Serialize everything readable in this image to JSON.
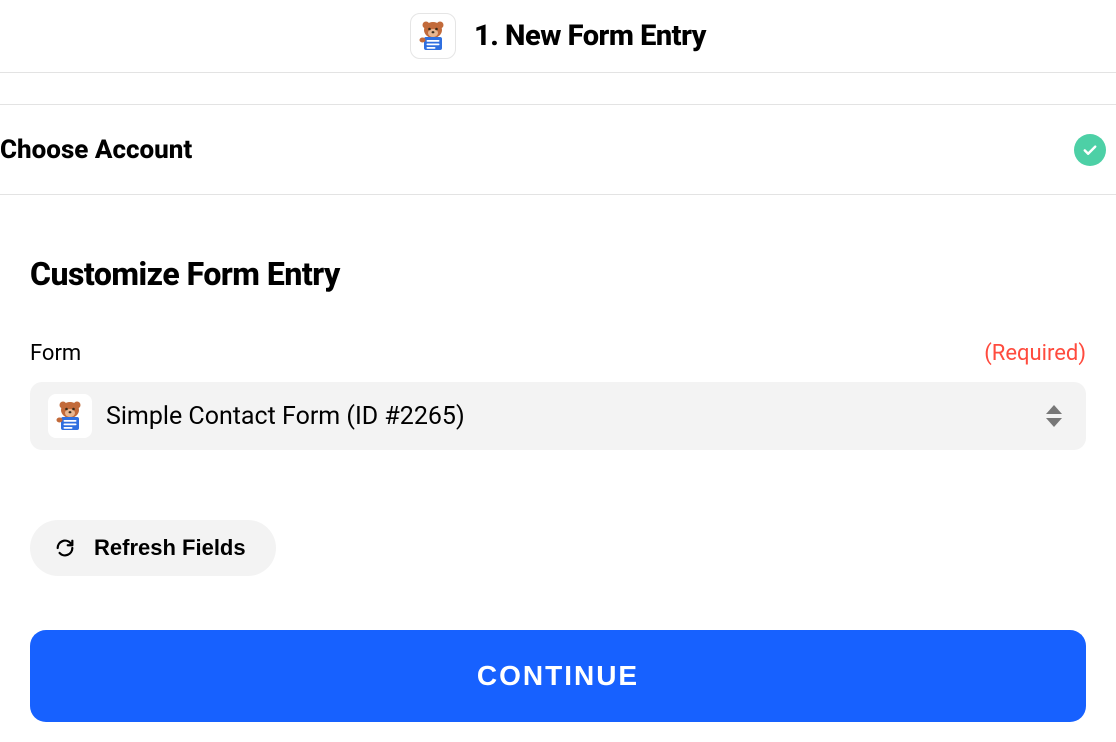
{
  "step": {
    "title": "1. New Form Entry"
  },
  "account": {
    "label": "Choose Account",
    "status": "complete"
  },
  "section": {
    "title": "Customize Form Entry"
  },
  "form_field": {
    "label": "Form",
    "required_text": "(Required)",
    "selected": "Simple Contact Form (ID #2265)"
  },
  "buttons": {
    "refresh": "Refresh Fields",
    "continue": "CONTINUE"
  },
  "icons": {
    "app": "wpforms-bear",
    "check": "check",
    "refresh": "refresh",
    "sort": "sort-arrows"
  }
}
